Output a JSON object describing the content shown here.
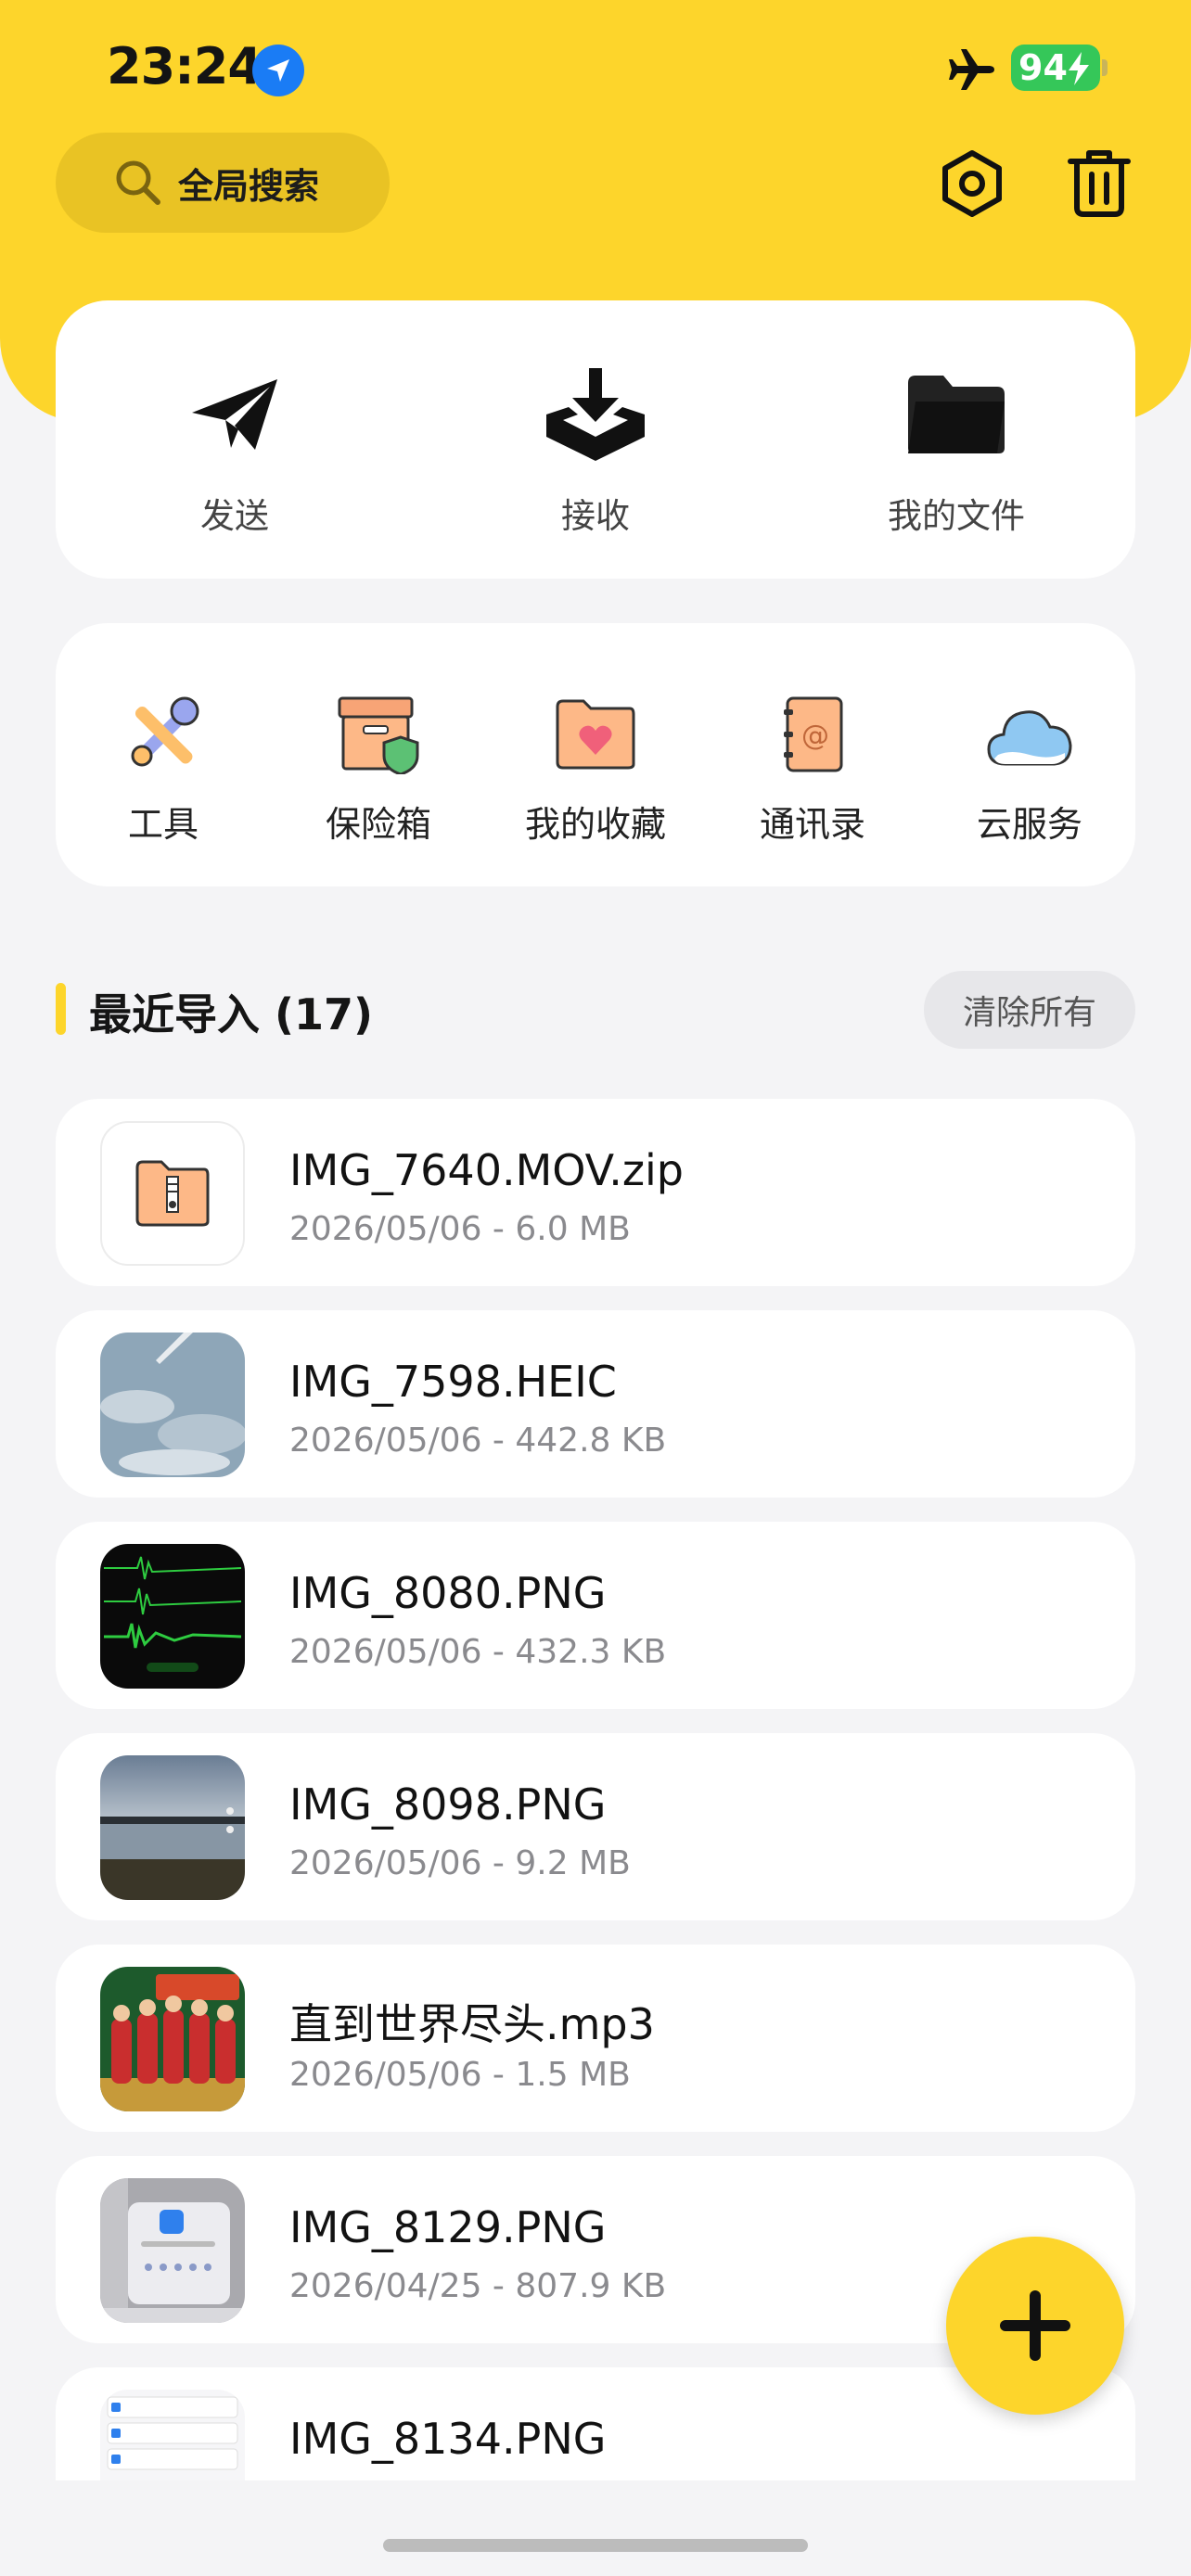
{
  "status_bar": {
    "time": "23:24",
    "battery": "94"
  },
  "header": {
    "search_label": "全局搜索",
    "settings_icon": "hexagon-settings-icon",
    "trash_icon": "trash-icon"
  },
  "main_actions": [
    {
      "label": "发送",
      "icon": "paper-plane-icon"
    },
    {
      "label": "接收",
      "icon": "download-tray-icon"
    },
    {
      "label": "我的文件",
      "icon": "folder-icon"
    }
  ],
  "tools": [
    {
      "label": "工具",
      "icon": "tools-icon"
    },
    {
      "label": "保险箱",
      "icon": "safe-box-icon"
    },
    {
      "label": "我的收藏",
      "icon": "favorite-folder-icon"
    },
    {
      "label": "通讯录",
      "icon": "contacts-book-icon"
    },
    {
      "label": "云服务",
      "icon": "cloud-icon"
    }
  ],
  "recent": {
    "title": "最近导入 (17)",
    "clear_label": "清除所有",
    "files": [
      {
        "name": "IMG_7640.MOV.zip",
        "meta": "2026/05/06 -  6.0 MB",
        "thumb": "zip"
      },
      {
        "name": "IMG_7598.HEIC",
        "meta": "2026/05/06 -  442.8 KB",
        "thumb": "sky"
      },
      {
        "name": "IMG_8080.PNG",
        "meta": "2026/05/06 -  432.3 KB",
        "thumb": "wave"
      },
      {
        "name": "IMG_8098.PNG",
        "meta": "2026/05/06 -  9.2 MB",
        "thumb": "lake"
      },
      {
        "name": "直到世界尽头.mp3",
        "meta": "2026/05/06 -  1.5 MB",
        "thumb": "album"
      },
      {
        "name": "IMG_8129.PNG",
        "meta": "2026/04/25 -  807.9 KB",
        "thumb": "dialog"
      },
      {
        "name": "IMG_8134.PNG",
        "meta": "",
        "thumb": "list"
      }
    ]
  },
  "colors": {
    "accent": "#fdd52b",
    "background": "#f4f4f6",
    "text": "#141414",
    "meta": "#8a8a8e"
  }
}
